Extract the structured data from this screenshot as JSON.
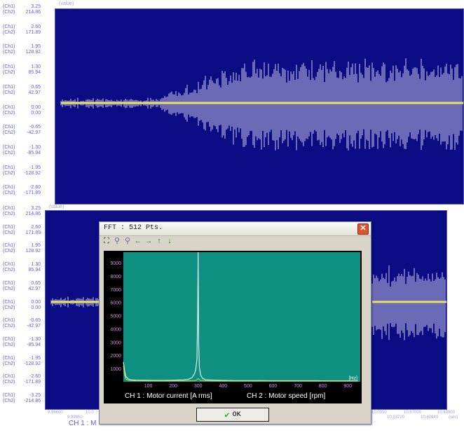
{
  "top_chart": {
    "unit_label": "(value)",
    "axis_rows": [
      {
        "ch1": "(Ch1)",
        "v1": "3.25",
        "ch2": "(Ch2)",
        "v2": "214.86"
      },
      {
        "ch1": "(Ch1)",
        "v1": "2.60",
        "ch2": "(Ch2)",
        "v2": "171.89"
      },
      {
        "ch1": "(Ch1)",
        "v1": "1.95",
        "ch2": "(Ch2)",
        "v2": "128.92"
      },
      {
        "ch1": "(Ch1)",
        "v1": "1.30",
        "ch2": "(Ch2)",
        "v2": "85.94"
      },
      {
        "ch1": "(Ch1)",
        "v1": "0.65",
        "ch2": "(Ch2)",
        "v2": "42.97"
      },
      {
        "ch1": "(Ch1)",
        "v1": "0.00",
        "ch2": "(Ch2)",
        "v2": "0.00"
      },
      {
        "ch1": "(Ch1)",
        "v1": "-0.65",
        "ch2": "(Ch2)",
        "v2": "-42.97"
      },
      {
        "ch1": "(Ch1)",
        "v1": "-1.30",
        "ch2": "(Ch2)",
        "v2": "-85.94"
      },
      {
        "ch1": "(Ch1)",
        "v1": "-1.95",
        "ch2": "(Ch2)",
        "v2": "-128.92"
      },
      {
        "ch1": "(Ch1)",
        "v1": "-2.60",
        "ch2": "(Ch2)",
        "v2": "-171.89"
      }
    ]
  },
  "bottom_chart": {
    "unit_label": "(value)",
    "axis_rows": [
      {
        "ch1": "(Ch1)",
        "v1": "3.25",
        "ch2": "(Ch2)",
        "v2": "214.86"
      },
      {
        "ch1": "(Ch1)",
        "v1": "2.60",
        "ch2": "(Ch2)",
        "v2": "171.89"
      },
      {
        "ch1": "(Ch1)",
        "v1": "1.95",
        "ch2": "(Ch2)",
        "v2": "128.92"
      },
      {
        "ch1": "(Ch1)",
        "v1": "1.30",
        "ch2": "(Ch2)",
        "v2": "85.94"
      },
      {
        "ch1": "(Ch1)",
        "v1": "0.65",
        "ch2": "(Ch2)",
        "v2": "42.97"
      },
      {
        "ch1": "(Ch1)",
        "v1": "0.00",
        "ch2": "(Ch2)",
        "v2": "0.00"
      },
      {
        "ch1": "(Ch1)",
        "v1": "-0.65",
        "ch2": "(Ch2)",
        "v2": "-42.97"
      },
      {
        "ch1": "(Ch1)",
        "v1": "-1.30",
        "ch2": "(Ch2)",
        "v2": "-85.94"
      },
      {
        "ch1": "(Ch1)",
        "v1": "-1.95",
        "ch2": "(Ch2)",
        "v2": "-128.92"
      },
      {
        "ch1": "(Ch1)",
        "v1": "-2.60",
        "ch2": "(Ch2)",
        "v2": "-171.89"
      },
      {
        "ch1": "(Ch1)",
        "v1": "-3.25",
        "ch2": "(Ch2)",
        "v2": "-214.86"
      }
    ],
    "x_ticks_left": [
      "9.96600",
      "10.0"
    ],
    "x_ticks_left2": [
      "9.99950"
    ],
    "x_ticks_right": [
      "10.0350",
      "10.57000",
      "10.63800"
    ],
    "x_ticks_right2": [
      "10.53720",
      "10.60940"
    ],
    "x_unit": "(sec)",
    "bottom_caption": "CH 1 : M"
  },
  "dialog": {
    "title": "FFT : 512 Pts.",
    "close_label": "✕",
    "ok_label": "OK"
  },
  "chart_data": {
    "type": "line",
    "title": "",
    "xlabel": "Hz",
    "ylabel": "",
    "x_ticks": [
      100,
      200,
      300,
      400,
      500,
      600,
      700,
      800,
      900
    ],
    "y_ticks": [
      1000,
      2000,
      3000,
      4000,
      5000,
      6000,
      7000,
      8000,
      9000
    ],
    "xlim": [
      0,
      950
    ],
    "ylim": [
      0,
      9800
    ],
    "series": [
      {
        "name": "CH 1 : Motor current [A rms]",
        "x": [
          0,
          5,
          10,
          20,
          30,
          50,
          80,
          120,
          160,
          200,
          240,
          260,
          275,
          285,
          290,
          295,
          298,
          300,
          302,
          305,
          310,
          318,
          330,
          360,
          400,
          450,
          500,
          550,
          600,
          650,
          700,
          750,
          800,
          850,
          900,
          940
        ],
        "values": [
          1500,
          800,
          400,
          200,
          150,
          120,
          110,
          100,
          100,
          110,
          140,
          180,
          300,
          600,
          900,
          1700,
          5000,
          9800,
          3000,
          1100,
          500,
          250,
          150,
          120,
          100,
          90,
          90,
          85,
          80,
          80,
          80,
          80,
          75,
          75,
          75,
          75
        ]
      },
      {
        "name": "CH 2 : Motor speed [rpm]",
        "x": [
          0,
          5,
          10,
          20,
          50,
          100,
          150,
          200,
          250,
          290,
          300,
          310,
          350,
          400,
          500,
          600,
          700,
          800,
          900,
          940
        ],
        "values": [
          1200,
          500,
          200,
          100,
          80,
          70,
          70,
          70,
          70,
          80,
          250,
          80,
          70,
          60,
          60,
          60,
          60,
          60,
          60,
          60
        ]
      }
    ],
    "legend": [
      "CH 1 : Motor current [A rms]",
      "CH 2 : Motor speed [rpm]"
    ],
    "colors": {
      "background": "#0f8f7f",
      "ch1": "#d8f0ee",
      "ch2": "#c2d84a",
      "axis": "#ffffff",
      "tick_label": "#d090e8"
    }
  }
}
